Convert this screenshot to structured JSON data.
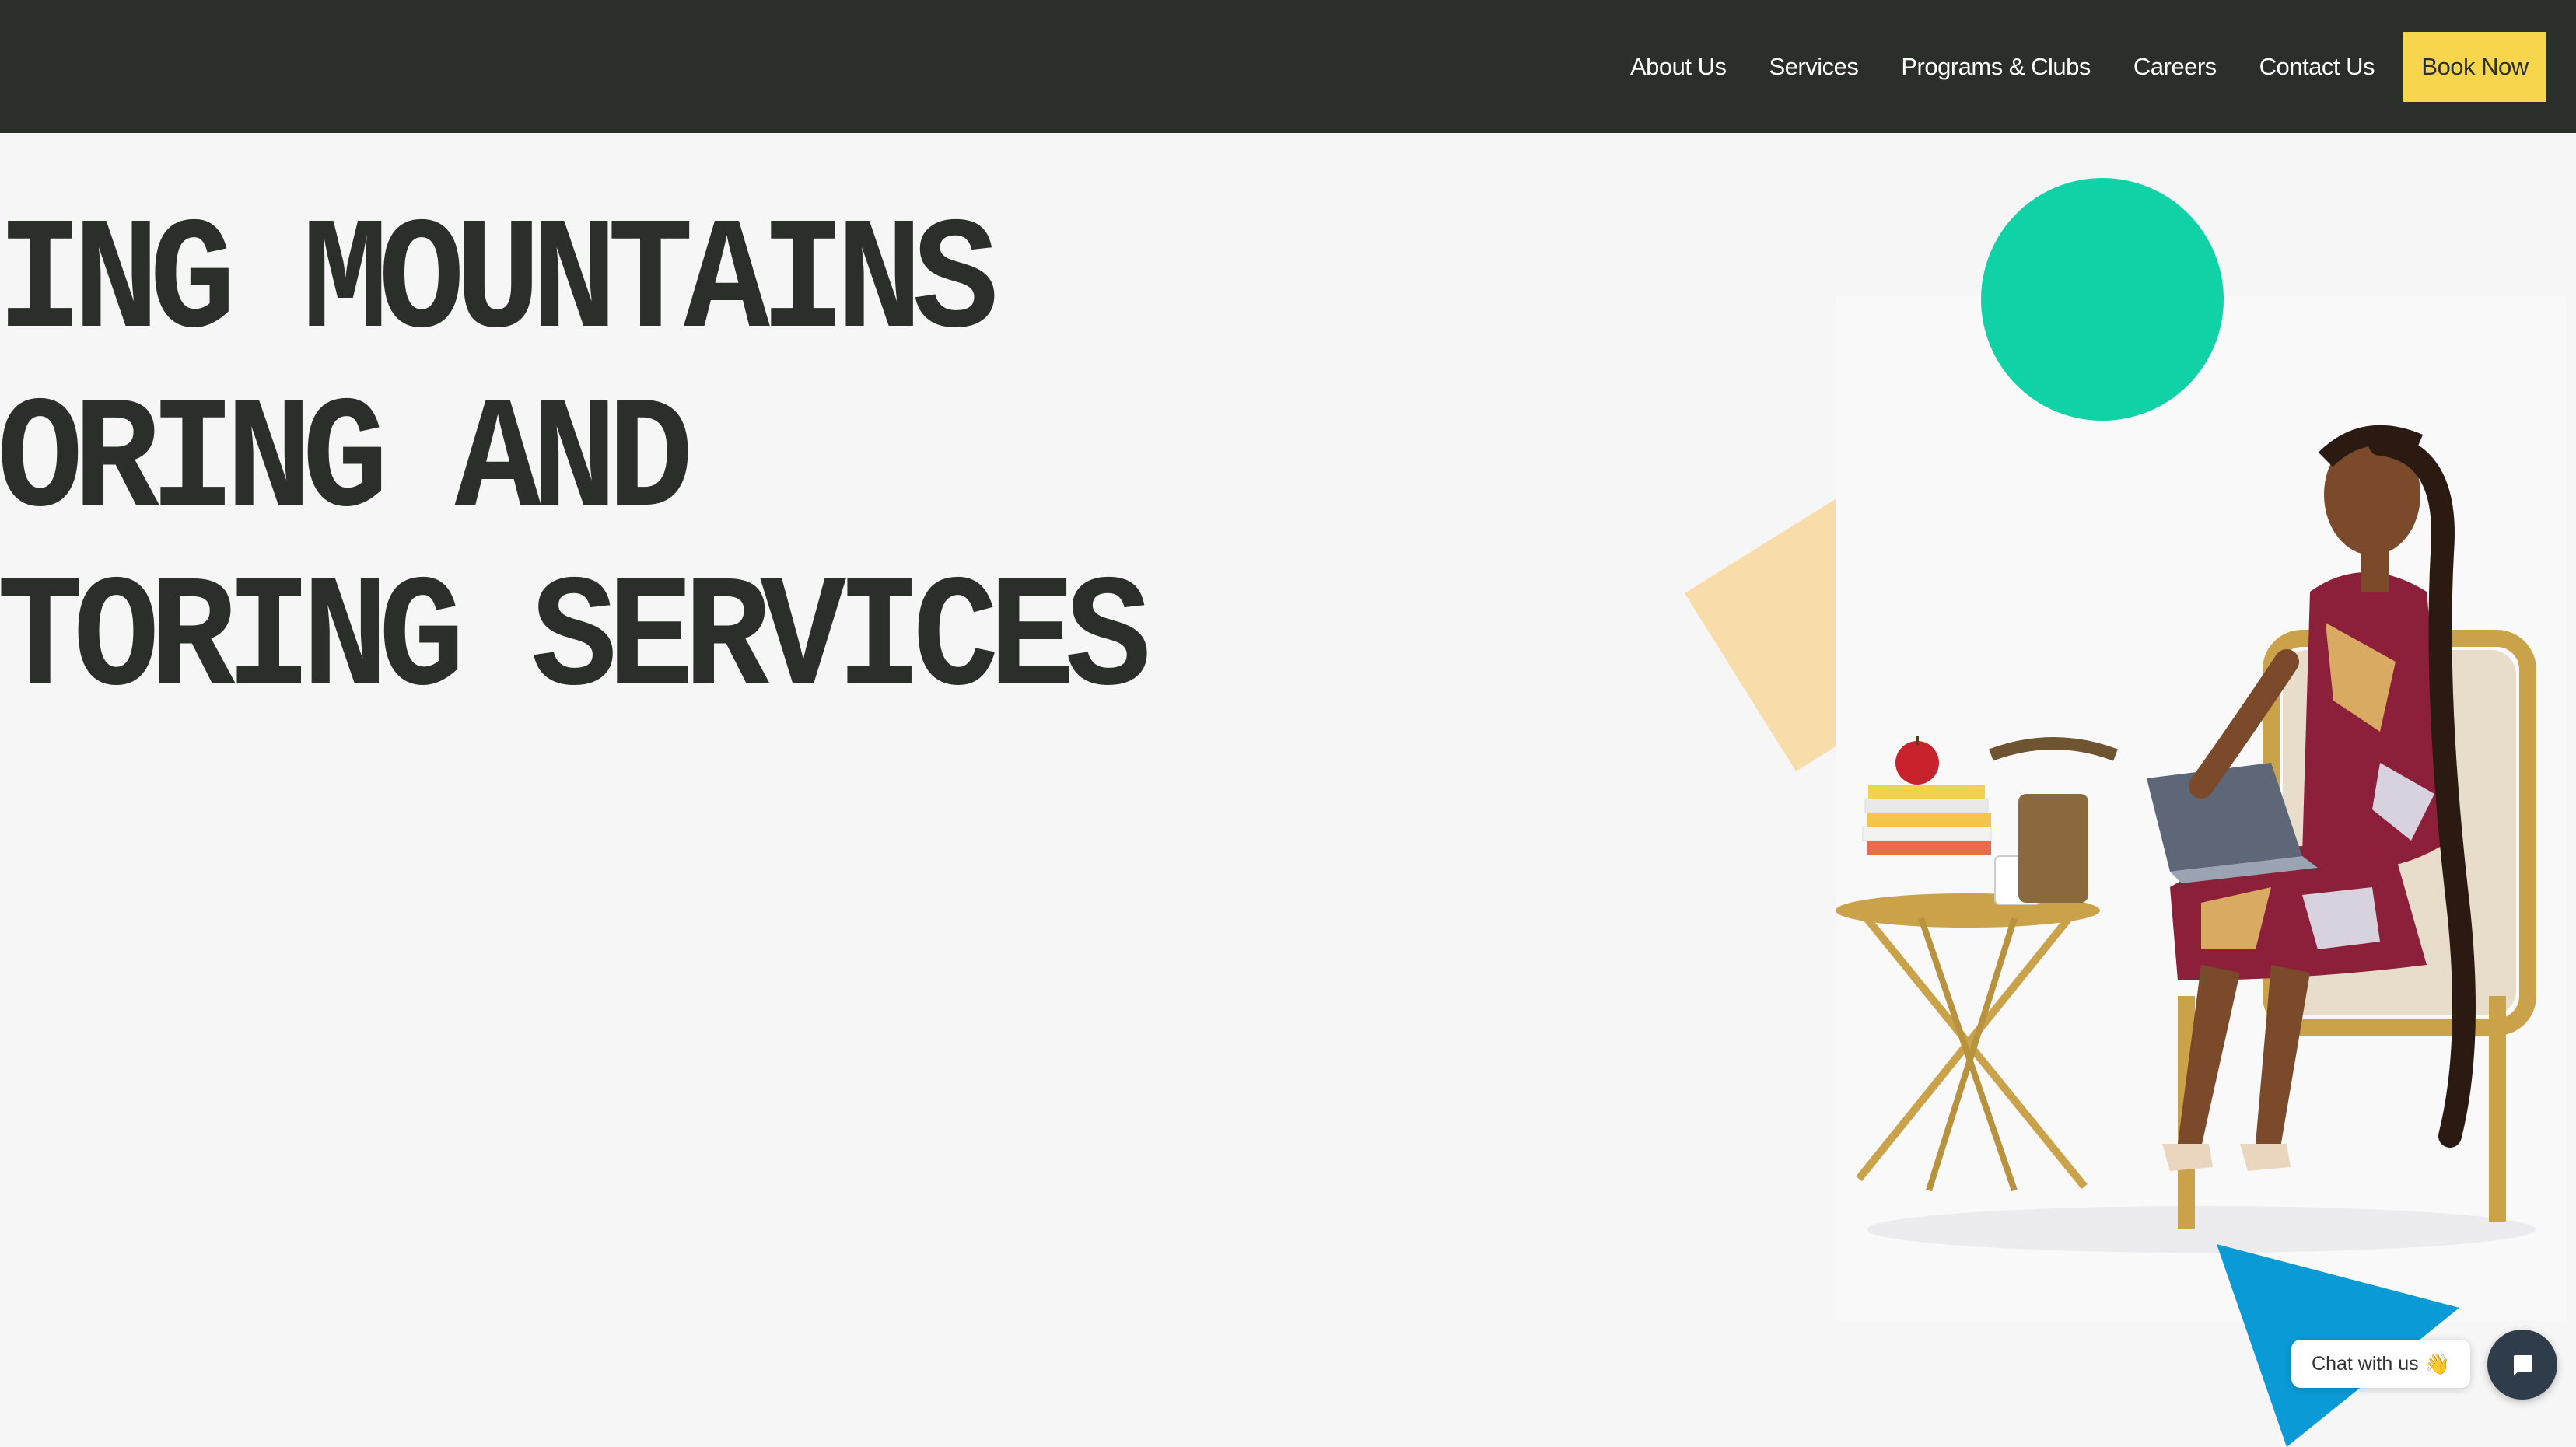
{
  "header": {
    "nav": [
      {
        "label": "About Us"
      },
      {
        "label": "Services"
      },
      {
        "label": "Programs & Clubs"
      },
      {
        "label": "Careers"
      },
      {
        "label": "Contact Us"
      }
    ],
    "book_label": "Book Now"
  },
  "hero": {
    "lines": [
      "ING MOUNTAINS",
      "ORING AND",
      "TORING SERVICES"
    ]
  },
  "chat": {
    "label": "Chat with us",
    "emoji": "👋",
    "launcher_icon": "chat-bubble-icon"
  },
  "colors": {
    "header_bg": "#2b2f2a",
    "page_bg": "#f6f6f6",
    "accent_button": "#f7d54d",
    "circle": "#10d2a6",
    "diamond": "#f8dca9",
    "triangle": "#0a9bd6",
    "chat_launcher": "#2f3c4a"
  }
}
